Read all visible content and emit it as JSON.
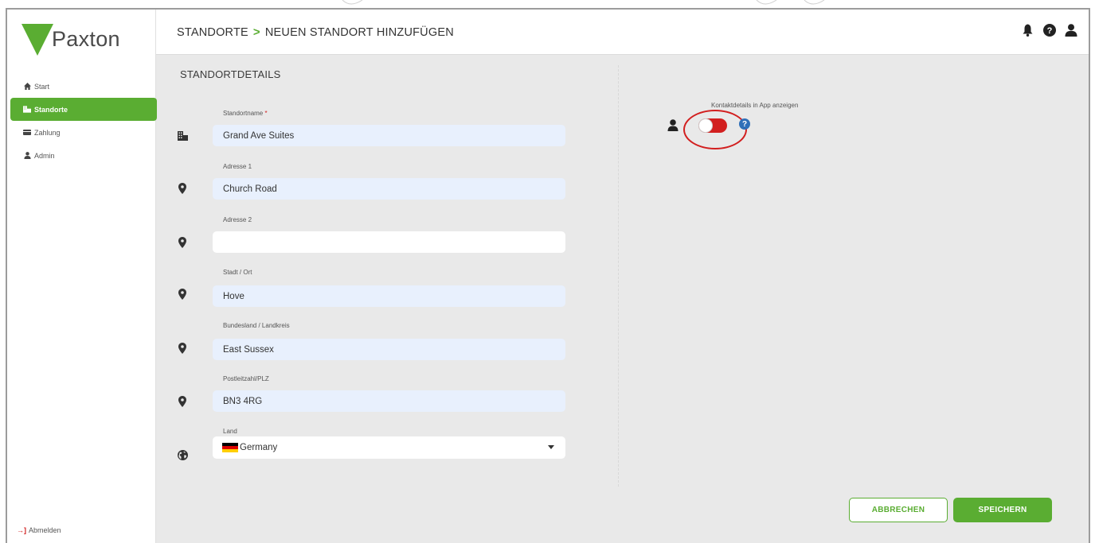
{
  "app": {
    "logo_text": "Paxton"
  },
  "sidebar": {
    "items": [
      {
        "label": "Start",
        "icon": "home-icon",
        "active": false
      },
      {
        "label": "Standorte",
        "icon": "building-icon",
        "active": true
      },
      {
        "label": "Zahlung",
        "icon": "card-icon",
        "active": false
      },
      {
        "label": "Admin",
        "icon": "user-icon",
        "active": false
      }
    ],
    "logout_label": "Abmelden"
  },
  "header": {
    "breadcrumb": [
      "STANDORTE",
      "NEUEN STANDORT HINZUFÜGEN"
    ],
    "icons": [
      "bell-icon",
      "help-icon",
      "user-icon"
    ]
  },
  "form": {
    "section_title": "STANDORTDETAILS",
    "fields": [
      {
        "label": "Standortname",
        "required_mark": "*",
        "value": "Grand Ave Suites",
        "icon": "building-icon"
      },
      {
        "label": "Adresse 1",
        "value": "Church Road",
        "icon": "map-pin-icon"
      },
      {
        "label": "Adresse 2",
        "value": "",
        "icon": "map-pin-icon"
      },
      {
        "label": "Stadt / Ort",
        "value": "Hove",
        "icon": "map-pin-icon"
      },
      {
        "label": "Bundesland / Landkreis",
        "value": "East Sussex",
        "icon": "map-pin-icon"
      },
      {
        "label": "Postleitzahl/PLZ",
        "value": "BN3 4RG",
        "icon": "map-pin-icon"
      }
    ],
    "country": {
      "label": "Land",
      "value": "Germany",
      "icon": "globe-icon"
    },
    "contact_toggle": {
      "label": "Kontaktdetails in App anzeigen",
      "help": "?"
    },
    "buttons": {
      "cancel": "ABBRECHEN",
      "save": "SPEICHERN"
    }
  },
  "colors": {
    "accent": "#5aad32",
    "toggle_on": "#d21f1f",
    "input_bg": "#e8f0fd",
    "content_bg": "#e9e9e9"
  }
}
